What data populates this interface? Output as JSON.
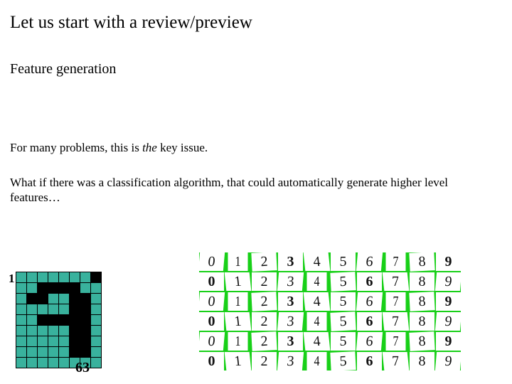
{
  "title": "Let us start with a review/preview",
  "subtitle": "Feature generation",
  "line1_pre": "For many problems, this is ",
  "line1_em": "the",
  "line1_post": " key issue.",
  "line2": "What if there was a classification algorithm, that could automatically generate higher level features…",
  "label_top": "1",
  "label_bottom": "63",
  "pixel_grid": {
    "cols": 8,
    "palette": {
      "0": "#39b29d",
      "1": "#000000"
    },
    "rows": [
      [
        0,
        0,
        0,
        0,
        0,
        0,
        0,
        1
      ],
      [
        0,
        0,
        1,
        1,
        1,
        1,
        0,
        0
      ],
      [
        0,
        1,
        1,
        0,
        0,
        1,
        1,
        0
      ],
      [
        0,
        0,
        0,
        0,
        0,
        1,
        1,
        0
      ],
      [
        0,
        0,
        1,
        1,
        1,
        1,
        1,
        0
      ],
      [
        0,
        0,
        0,
        0,
        0,
        1,
        1,
        0
      ],
      [
        0,
        0,
        0,
        0,
        0,
        1,
        1,
        0
      ],
      [
        0,
        0,
        0,
        0,
        0,
        1,
        1,
        0
      ],
      [
        0,
        0,
        0,
        0,
        0,
        0,
        0,
        0
      ]
    ]
  },
  "mosaic": {
    "cols": 10,
    "rows": [
      [
        "0",
        "1",
        "2",
        "3",
        "4",
        "5",
        "6",
        "7",
        "8",
        "9"
      ],
      [
        "0",
        "1",
        "2",
        "3",
        "4",
        "5",
        "6",
        "7",
        "8",
        "9"
      ],
      [
        "0",
        "1",
        "2",
        "3",
        "4",
        "5",
        "6",
        "7",
        "8",
        "9"
      ],
      [
        "0",
        "1",
        "2",
        "3",
        "4",
        "5",
        "6",
        "7",
        "8",
        "9"
      ],
      [
        "0",
        "1",
        "2",
        "3",
        "4",
        "5",
        "6",
        "7",
        "8",
        "9"
      ],
      [
        "0",
        "1",
        "2",
        "3",
        "4",
        "5",
        "6",
        "7",
        "8",
        "9"
      ]
    ]
  }
}
